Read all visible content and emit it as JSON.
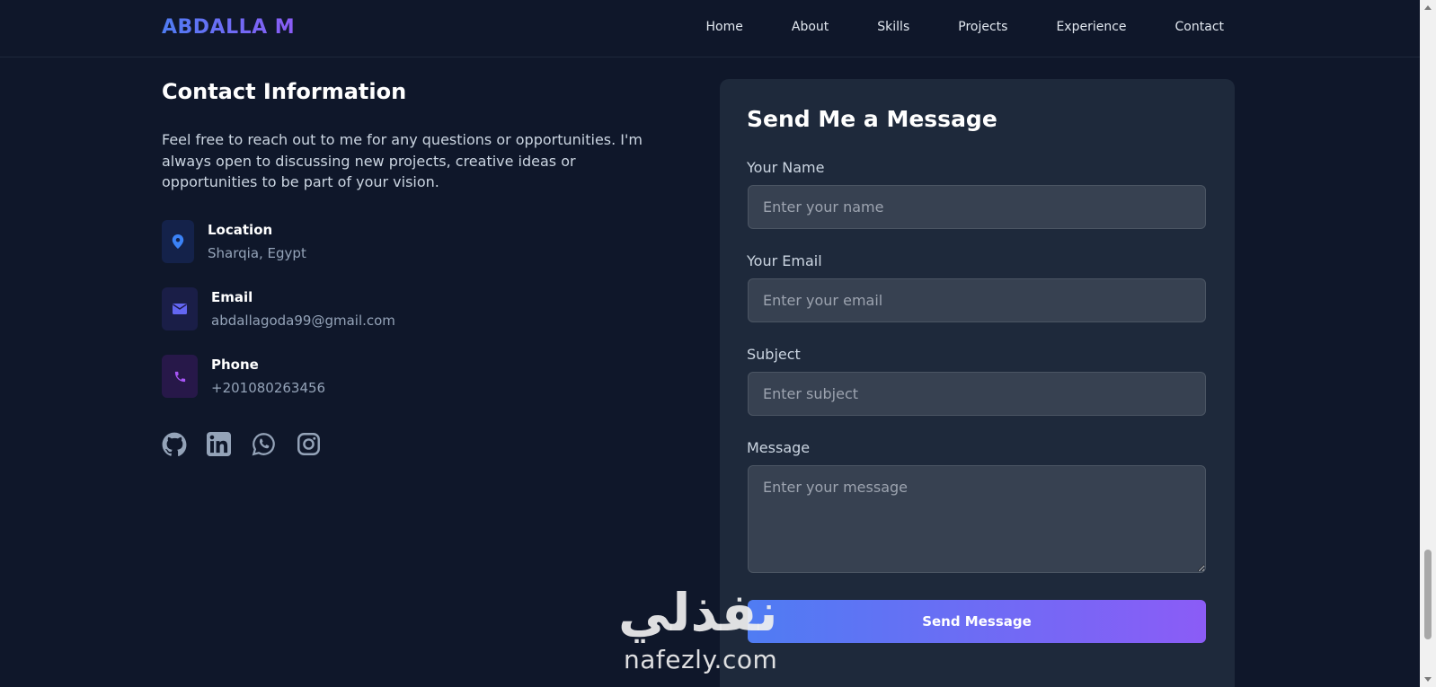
{
  "nav": {
    "brand": "ABDALLA M",
    "links": [
      "Home",
      "About",
      "Skills",
      "Projects",
      "Experience",
      "Contact"
    ]
  },
  "contact": {
    "title": "Contact Information",
    "description": "Feel free to reach out to me for any questions or opportunities. I'm always open to discussing new projects, creative ideas or opportunities to be part of your vision.",
    "items": [
      {
        "label": "Location",
        "value": "Sharqia, Egypt",
        "icon": "map-pin-icon",
        "color": "#3b82f6"
      },
      {
        "label": "Email",
        "value": "abdallagoda99@gmail.com",
        "icon": "envelope-icon",
        "color": "#6366f1"
      },
      {
        "label": "Phone",
        "value": "+201080263456",
        "icon": "phone-icon",
        "color": "#a855f7"
      }
    ],
    "socials": [
      "github-icon",
      "linkedin-icon",
      "whatsapp-icon",
      "instagram-icon"
    ]
  },
  "form": {
    "title": "Send Me a Message",
    "name_label": "Your Name",
    "name_placeholder": "Enter your name",
    "email_label": "Your Email",
    "email_placeholder": "Enter your email",
    "subject_label": "Subject",
    "subject_placeholder": "Enter subject",
    "message_label": "Message",
    "message_placeholder": "Enter your message",
    "submit_label": "Send Message"
  },
  "watermark": {
    "arabic": "نفذلي",
    "latin": "nafezly.com"
  },
  "colors": {
    "background": "#0f172a",
    "card": "#1e293b",
    "accent_start": "#4f7cf3",
    "accent_end": "#8b5cf6"
  }
}
